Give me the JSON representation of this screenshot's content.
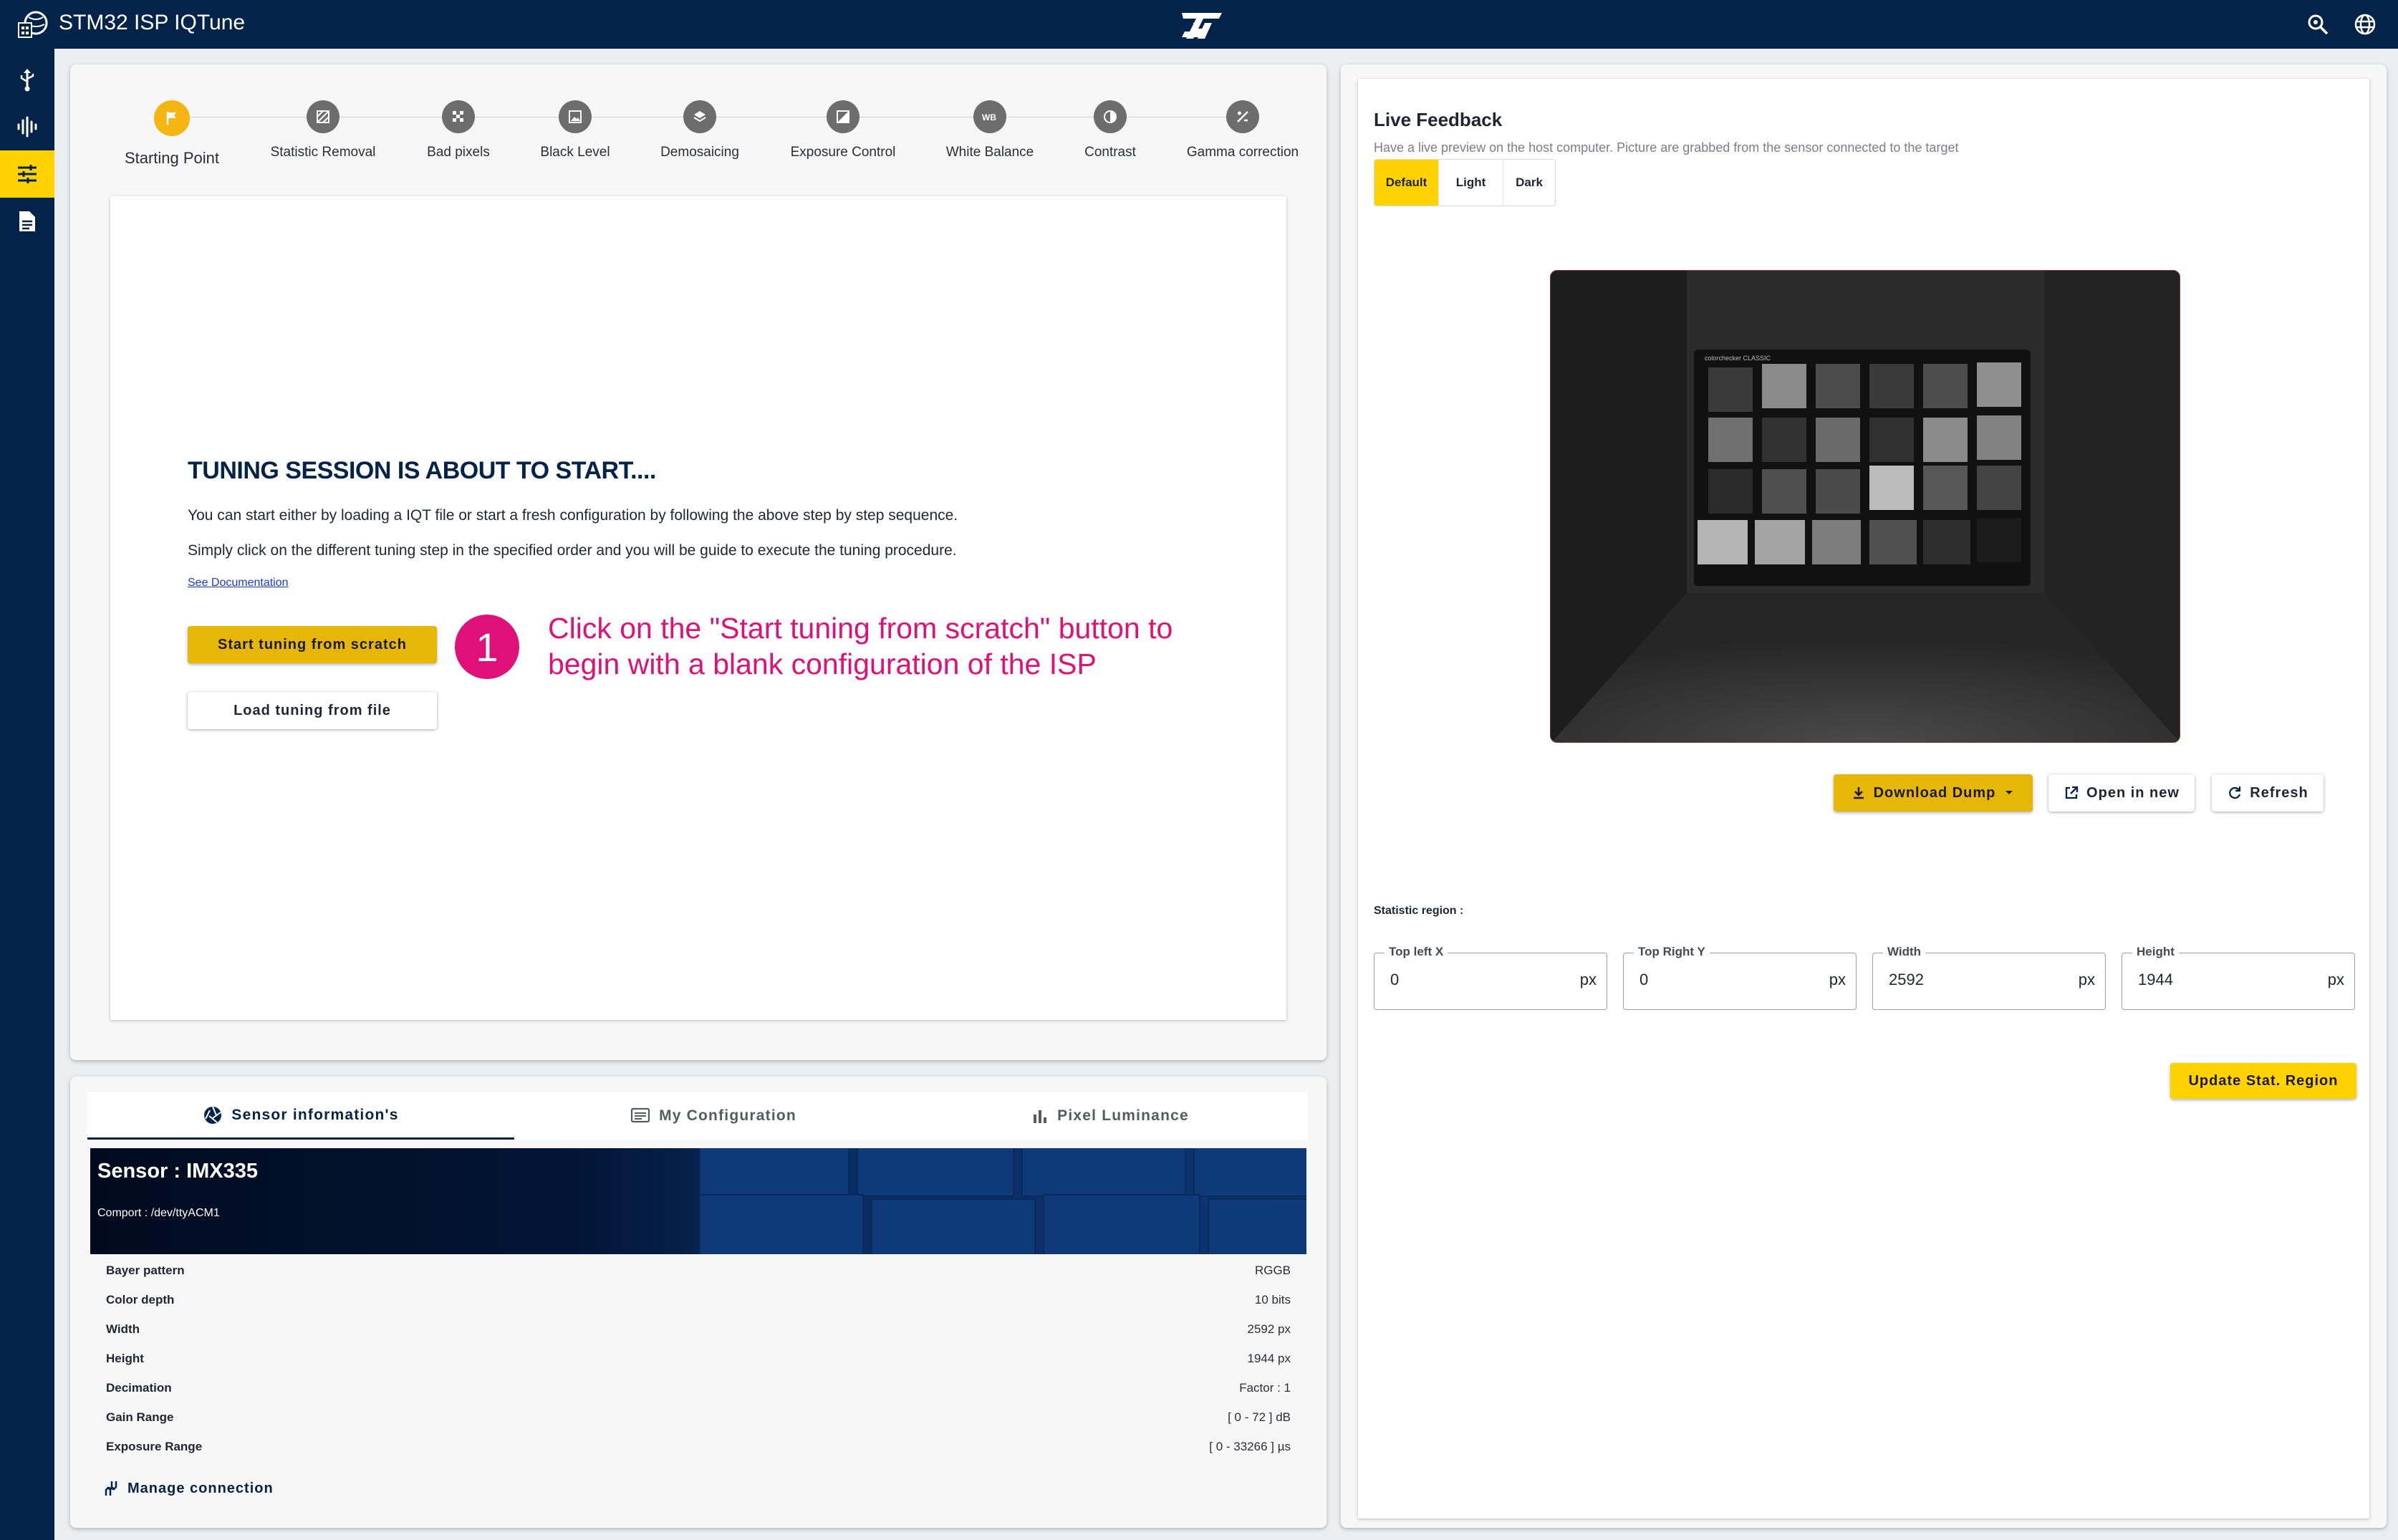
{
  "app": {
    "title": "STM32 ISP IQTune"
  },
  "steps": [
    {
      "label": "Starting Point"
    },
    {
      "label": "Statistic Removal"
    },
    {
      "label": "Bad pixels"
    },
    {
      "label": "Black Level"
    },
    {
      "label": "Demosaicing"
    },
    {
      "label": "Exposure Control"
    },
    {
      "label": "White Balance"
    },
    {
      "label": "Contrast"
    },
    {
      "label": "Gamma correction"
    }
  ],
  "welcome": {
    "title": "TUNING SESSION IS ABOUT TO START....",
    "p1": "You can start either by loading a IQT file or start a fresh configuration by following the above step by step sequence.",
    "p2": "Simply click on the different tuning step in the specified order and you will be guide to execute the tuning procedure.",
    "doc_link": "See Documentation",
    "start_btn": "Start tuning from scratch",
    "load_btn": "Load tuning from file"
  },
  "callout": {
    "number": "1",
    "text": "Click on the \"Start tuning from scratch\" button to begin with a blank configuration of the ISP"
  },
  "tabs": [
    {
      "label": "Sensor information's",
      "icon": "aperture-icon"
    },
    {
      "label": "My Configuration",
      "icon": "config-icon"
    },
    {
      "label": "Pixel Luminance",
      "icon": "bar-chart-icon"
    }
  ],
  "sensor": {
    "name": "Sensor : IMX335",
    "comport": "Comport : /dev/ttyACM1",
    "rows": [
      {
        "key": "Bayer pattern",
        "value": "RGGB"
      },
      {
        "key": "Color depth",
        "value": "10 bits"
      },
      {
        "key": "Width",
        "value": "2592 px"
      },
      {
        "key": "Height",
        "value": "1944 px"
      },
      {
        "key": "Decimation",
        "value": "Factor : 1"
      },
      {
        "key": "Gain Range",
        "value": "[ 0 - 72 ] dB"
      },
      {
        "key": "Exposure Range",
        "value": "[ 0 - 33266 ] µs"
      }
    ],
    "manage": "Manage connection"
  },
  "live": {
    "title": "Live Feedback",
    "subtitle": "Have a live preview on the host computer. Picture are grabbed from the sensor connected to the target",
    "modes": [
      "Default",
      "Light",
      "Dark"
    ],
    "selected_mode": "Default",
    "chart_label": "colorchecker CLASSIC",
    "download": "Download Dump",
    "open_new": "Open in new",
    "refresh": "Refresh"
  },
  "stat": {
    "label": "Statistic region :",
    "fields": [
      {
        "label": "Top left X",
        "value": "0",
        "unit": "px"
      },
      {
        "label": "Top Right Y",
        "value": "0",
        "unit": "px"
      },
      {
        "label": "Width",
        "value": "2592",
        "unit": "px"
      },
      {
        "label": "Height",
        "value": "1944",
        "unit": "px"
      }
    ],
    "update_btn": "Update Stat. Region"
  },
  "colors": {
    "brand_navy": "#03234b",
    "accent_yellow": "#ffd200",
    "callout_pink": "#e0107a"
  }
}
